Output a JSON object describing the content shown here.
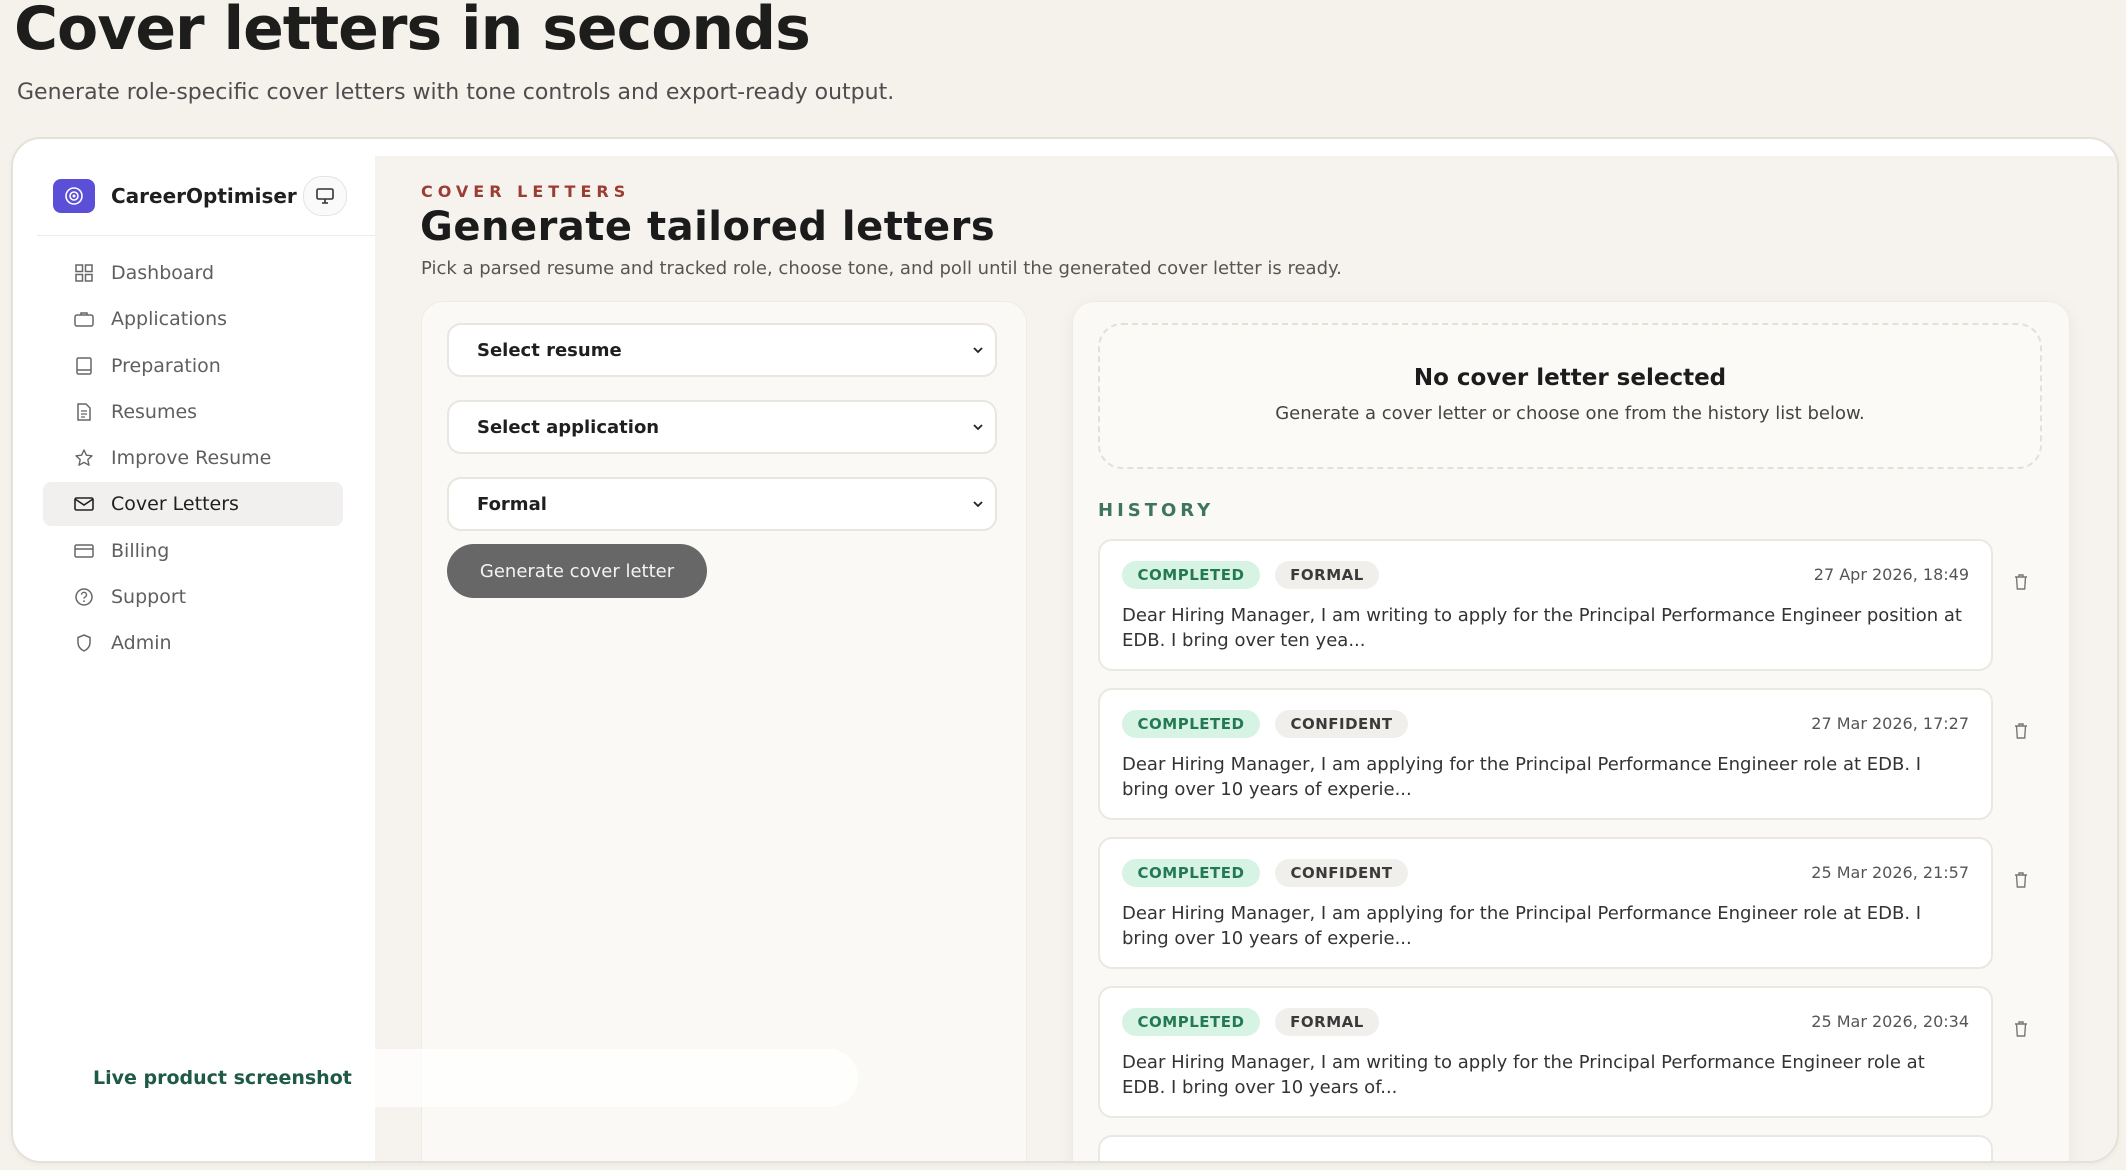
{
  "hero": {
    "title": "Cover letters in seconds",
    "subtitle": "Generate role-specific cover letters with tone controls and export-ready output."
  },
  "brand": {
    "name": "CareerOptimiser",
    "accent": "#5a4fd6"
  },
  "sidebar": {
    "items": [
      {
        "label": "Dashboard",
        "icon": "grid-icon"
      },
      {
        "label": "Applications",
        "icon": "briefcase-icon"
      },
      {
        "label": "Preparation",
        "icon": "book-icon"
      },
      {
        "label": "Resumes",
        "icon": "document-icon"
      },
      {
        "label": "Improve Resume",
        "icon": "star-icon"
      },
      {
        "label": "Cover Letters",
        "icon": "mail-icon",
        "active": true
      },
      {
        "label": "Billing",
        "icon": "credit-card-icon"
      },
      {
        "label": "Support",
        "icon": "help-circle-icon"
      },
      {
        "label": "Admin",
        "icon": "shield-icon"
      }
    ],
    "live_label": "Live product screenshot"
  },
  "main": {
    "eyebrow": "COVER LETTERS",
    "title": "Generate tailored letters",
    "subtitle": "Pick a parsed resume and tracked role, choose tone, and poll until the generated cover letter is ready."
  },
  "form": {
    "resume_select": "Select resume",
    "application_select": "Select application",
    "tone_select": "Formal",
    "generate_label": "Generate cover letter"
  },
  "preview": {
    "empty_title": "No cover letter selected",
    "empty_subtitle": "Generate a cover letter or choose one from the history list below."
  },
  "history": {
    "label": "HISTORY",
    "items": [
      {
        "status": "COMPLETED",
        "tone": "FORMAL",
        "date": "27 Apr 2026, 18:49",
        "text": "Dear Hiring Manager, I am writing to apply for the Principal Performance Engineer position at EDB. I bring over ten yea..."
      },
      {
        "status": "COMPLETED",
        "tone": "CONFIDENT",
        "date": "27 Mar 2026, 17:27",
        "text": "Dear Hiring Manager, I am applying for the Principal Performance Engineer role at EDB. I bring over 10 years of experie..."
      },
      {
        "status": "COMPLETED",
        "tone": "CONFIDENT",
        "date": "25 Mar 2026, 21:57",
        "text": "Dear Hiring Manager, I am applying for the Principal Performance Engineer role at EDB. I bring over 10 years of experie..."
      },
      {
        "status": "COMPLETED",
        "tone": "FORMAL",
        "date": "25 Mar 2026, 20:34",
        "text": "Dear Hiring Manager, I am writing to apply for the Principal Performance Engineer role at EDB. I bring over 10 years of..."
      }
    ]
  }
}
